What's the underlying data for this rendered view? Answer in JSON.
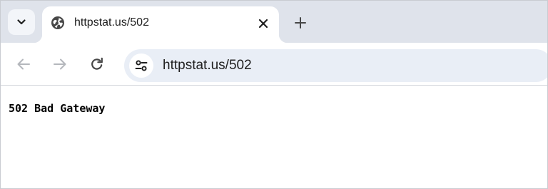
{
  "browser": {
    "tab": {
      "title": "httpstat.us/502",
      "favicon": "globe-icon"
    },
    "toolbar": {
      "back_icon": "back-arrow-icon",
      "forward_icon": "forward-arrow-icon",
      "reload_icon": "reload-icon",
      "site_info_icon": "tune-icon"
    },
    "omnibox": {
      "url": "httpstat.us/502"
    }
  },
  "page": {
    "body_text": "502 Bad Gateway"
  },
  "colors": {
    "tabstrip": "#dfe3eb",
    "omnibox": "#e9eef6",
    "icon": "#474747"
  }
}
